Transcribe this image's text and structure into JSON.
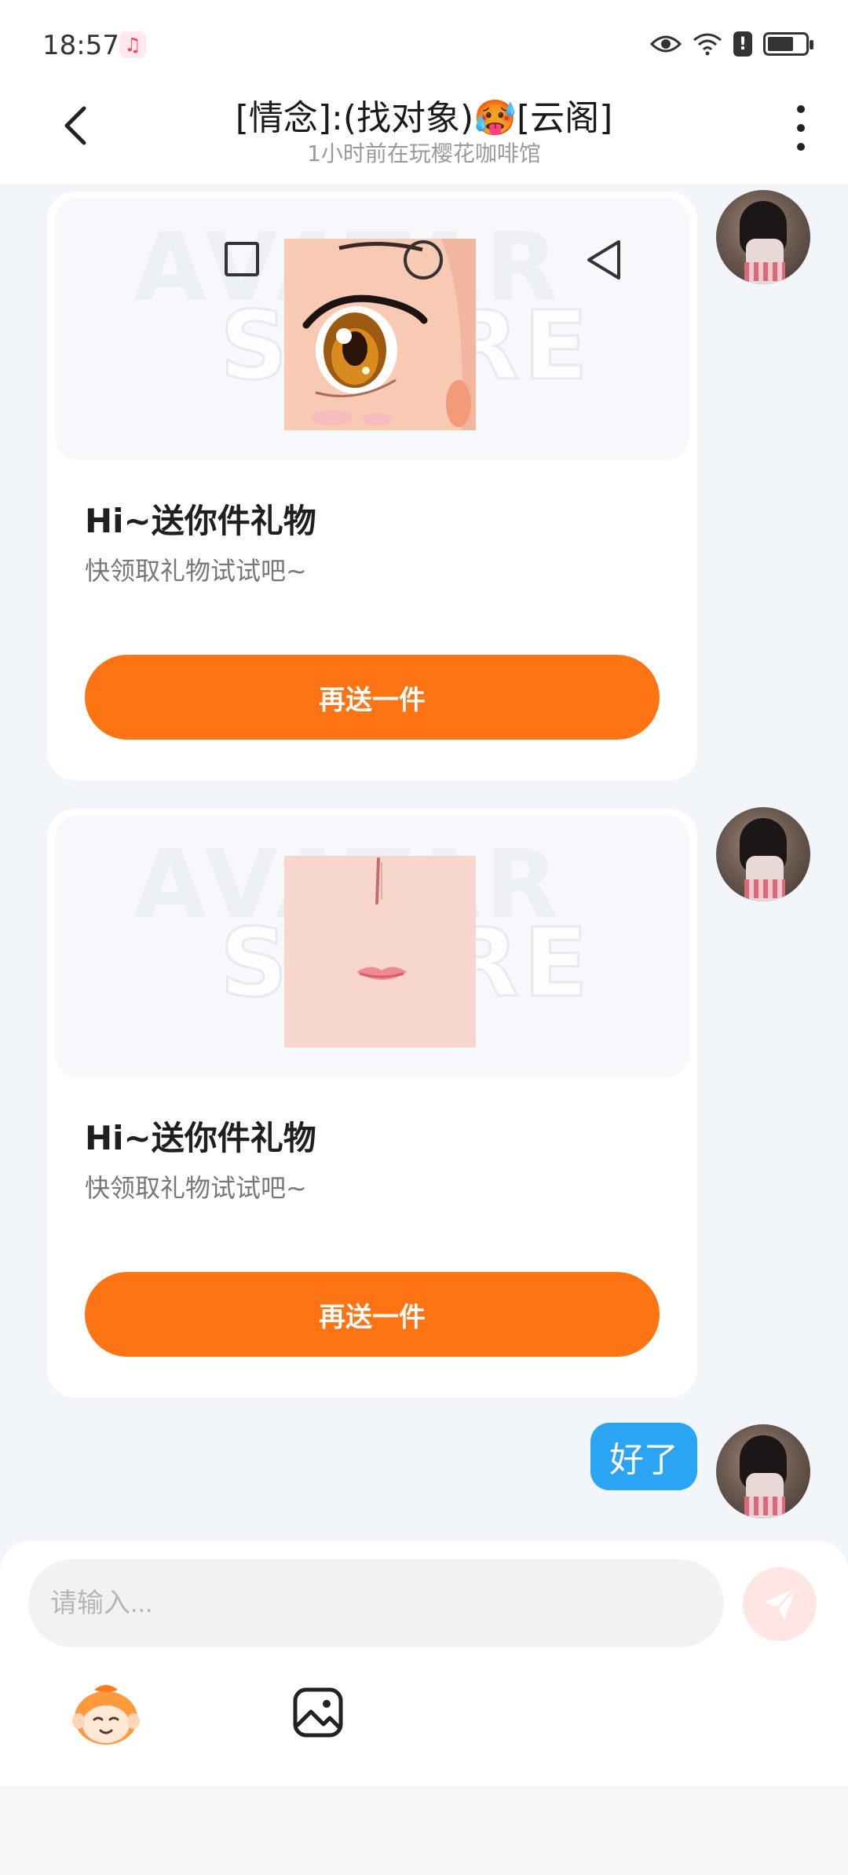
{
  "status": {
    "time": "18:57"
  },
  "header": {
    "title": "[情念]:(找对象)🥵[云阁]",
    "subtitle": "1小时前在玩樱花咖啡馆"
  },
  "messages": [
    {
      "type": "gift",
      "title": "Hi~送你件礼物",
      "subtitle": "快领取礼物试试吧~",
      "button": "再送一件",
      "watermark": [
        "AVATAR",
        "STORE"
      ]
    },
    {
      "type": "gift",
      "title": "Hi~送你件礼物",
      "subtitle": "快领取礼物试试吧~",
      "button": "再送一件",
      "watermark": [
        "AVATAR",
        "STORE"
      ]
    },
    {
      "type": "text",
      "text": "好了"
    }
  ],
  "input": {
    "placeholder": "请输入..."
  },
  "colors": {
    "accent": "#ff7412",
    "bubble": "#2aa5f4",
    "background": "#f2f5f9"
  }
}
